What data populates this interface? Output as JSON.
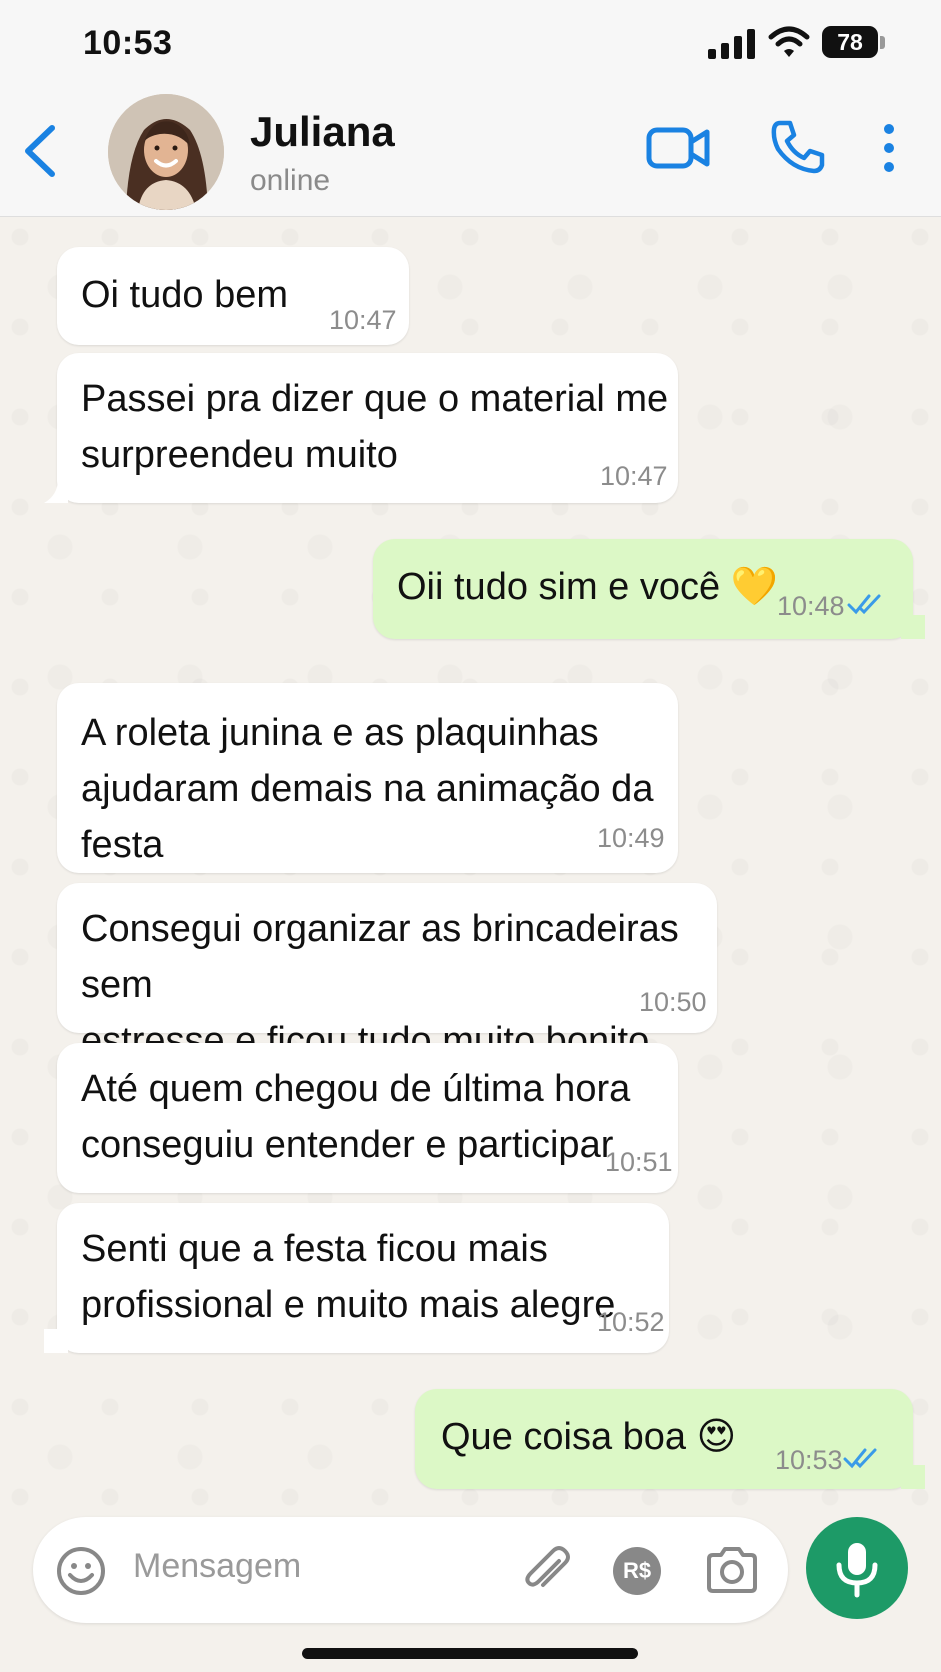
{
  "status_bar": {
    "time": "10:53",
    "battery": "78"
  },
  "header": {
    "contact_name": "Juliana",
    "contact_status": "online"
  },
  "messages": [
    {
      "direction": "in",
      "lines": [
        "Oi tudo bem"
      ],
      "time": "10:47"
    },
    {
      "direction": "in",
      "lines": [
        "Passei pra dizer que o material me",
        "surpreendeu muito"
      ],
      "time": "10:47"
    },
    {
      "direction": "out",
      "lines": [
        "Oii tudo sim e você 💛"
      ],
      "time": "10:48",
      "read": true
    },
    {
      "direction": "in",
      "lines": [
        "A roleta junina e as plaquinhas",
        "ajudaram demais na animação da festa"
      ],
      "time": "10:49"
    },
    {
      "direction": "in",
      "lines": [
        "Consegui organizar as brincadeiras sem",
        "estresse e ficou tudo muito bonito"
      ],
      "time": "10:50"
    },
    {
      "direction": "in",
      "lines": [
        "Até quem chegou de última hora",
        "conseguiu entender e participar"
      ],
      "time": "10:51"
    },
    {
      "direction": "in",
      "lines": [
        "Senti que a festa ficou mais",
        "profissional e muito mais alegre"
      ],
      "time": "10:52"
    },
    {
      "direction": "out",
      "lines": [
        "Que coisa boa 😍"
      ],
      "time": "10:53",
      "read": true
    }
  ],
  "input": {
    "placeholder": "Mensagem",
    "pix_label": "R$"
  },
  "colors": {
    "accent": "#1a82e2",
    "outgoing_bubble": "#dcf8c6",
    "mic_button": "#1d9a67",
    "read_ticks": "#3a9be8"
  },
  "icons": [
    "back-chevron-icon",
    "video-camera-icon",
    "phone-icon",
    "more-vertical-icon",
    "emoji-icon",
    "paperclip-icon",
    "pix-icon",
    "camera-icon",
    "microphone-icon"
  ]
}
